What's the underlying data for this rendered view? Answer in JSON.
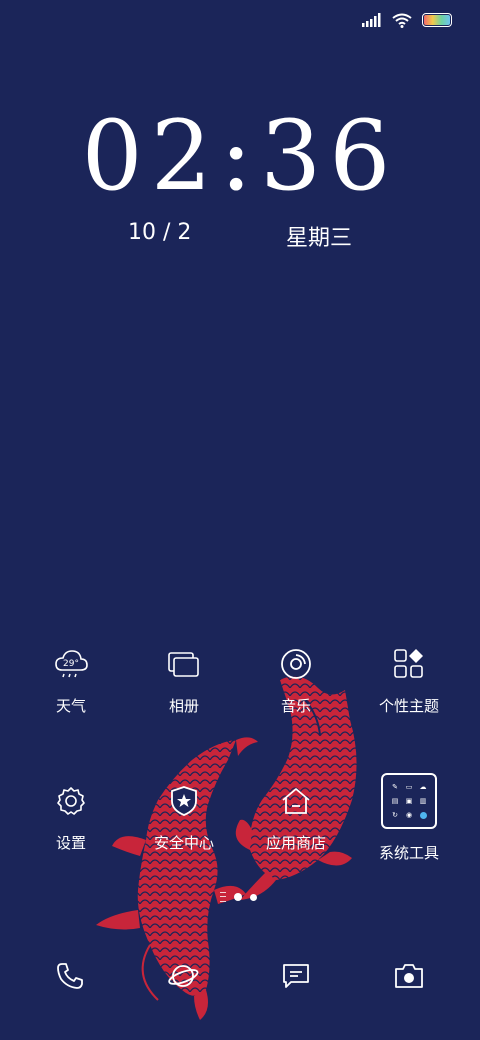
{
  "status_bar": {
    "signal": "signal-icon",
    "wifi": "wifi-icon",
    "battery": "battery-icon"
  },
  "lock": {
    "time": "02:36",
    "date": "10 / 2",
    "weekday": "星期三"
  },
  "apps": [
    {
      "label": "天气",
      "icon": "weather-icon",
      "temp": "29°"
    },
    {
      "label": "相册",
      "icon": "gallery-icon"
    },
    {
      "label": "音乐",
      "icon": "music-icon"
    },
    {
      "label": "个性主题",
      "icon": "themes-icon"
    },
    {
      "label": "设置",
      "icon": "settings-icon"
    },
    {
      "label": "安全中心",
      "icon": "security-icon"
    },
    {
      "label": "应用商店",
      "icon": "app-store-icon"
    },
    {
      "label": "系统工具",
      "icon": "system-tools-folder"
    }
  ],
  "dock": [
    {
      "icon": "phone-icon"
    },
    {
      "icon": "browser-icon"
    },
    {
      "icon": "messages-icon"
    },
    {
      "icon": "camera-icon"
    }
  ],
  "colors": {
    "background": "#1b2559",
    "koi": "#c8253a",
    "accent": "#4fb5ef"
  }
}
